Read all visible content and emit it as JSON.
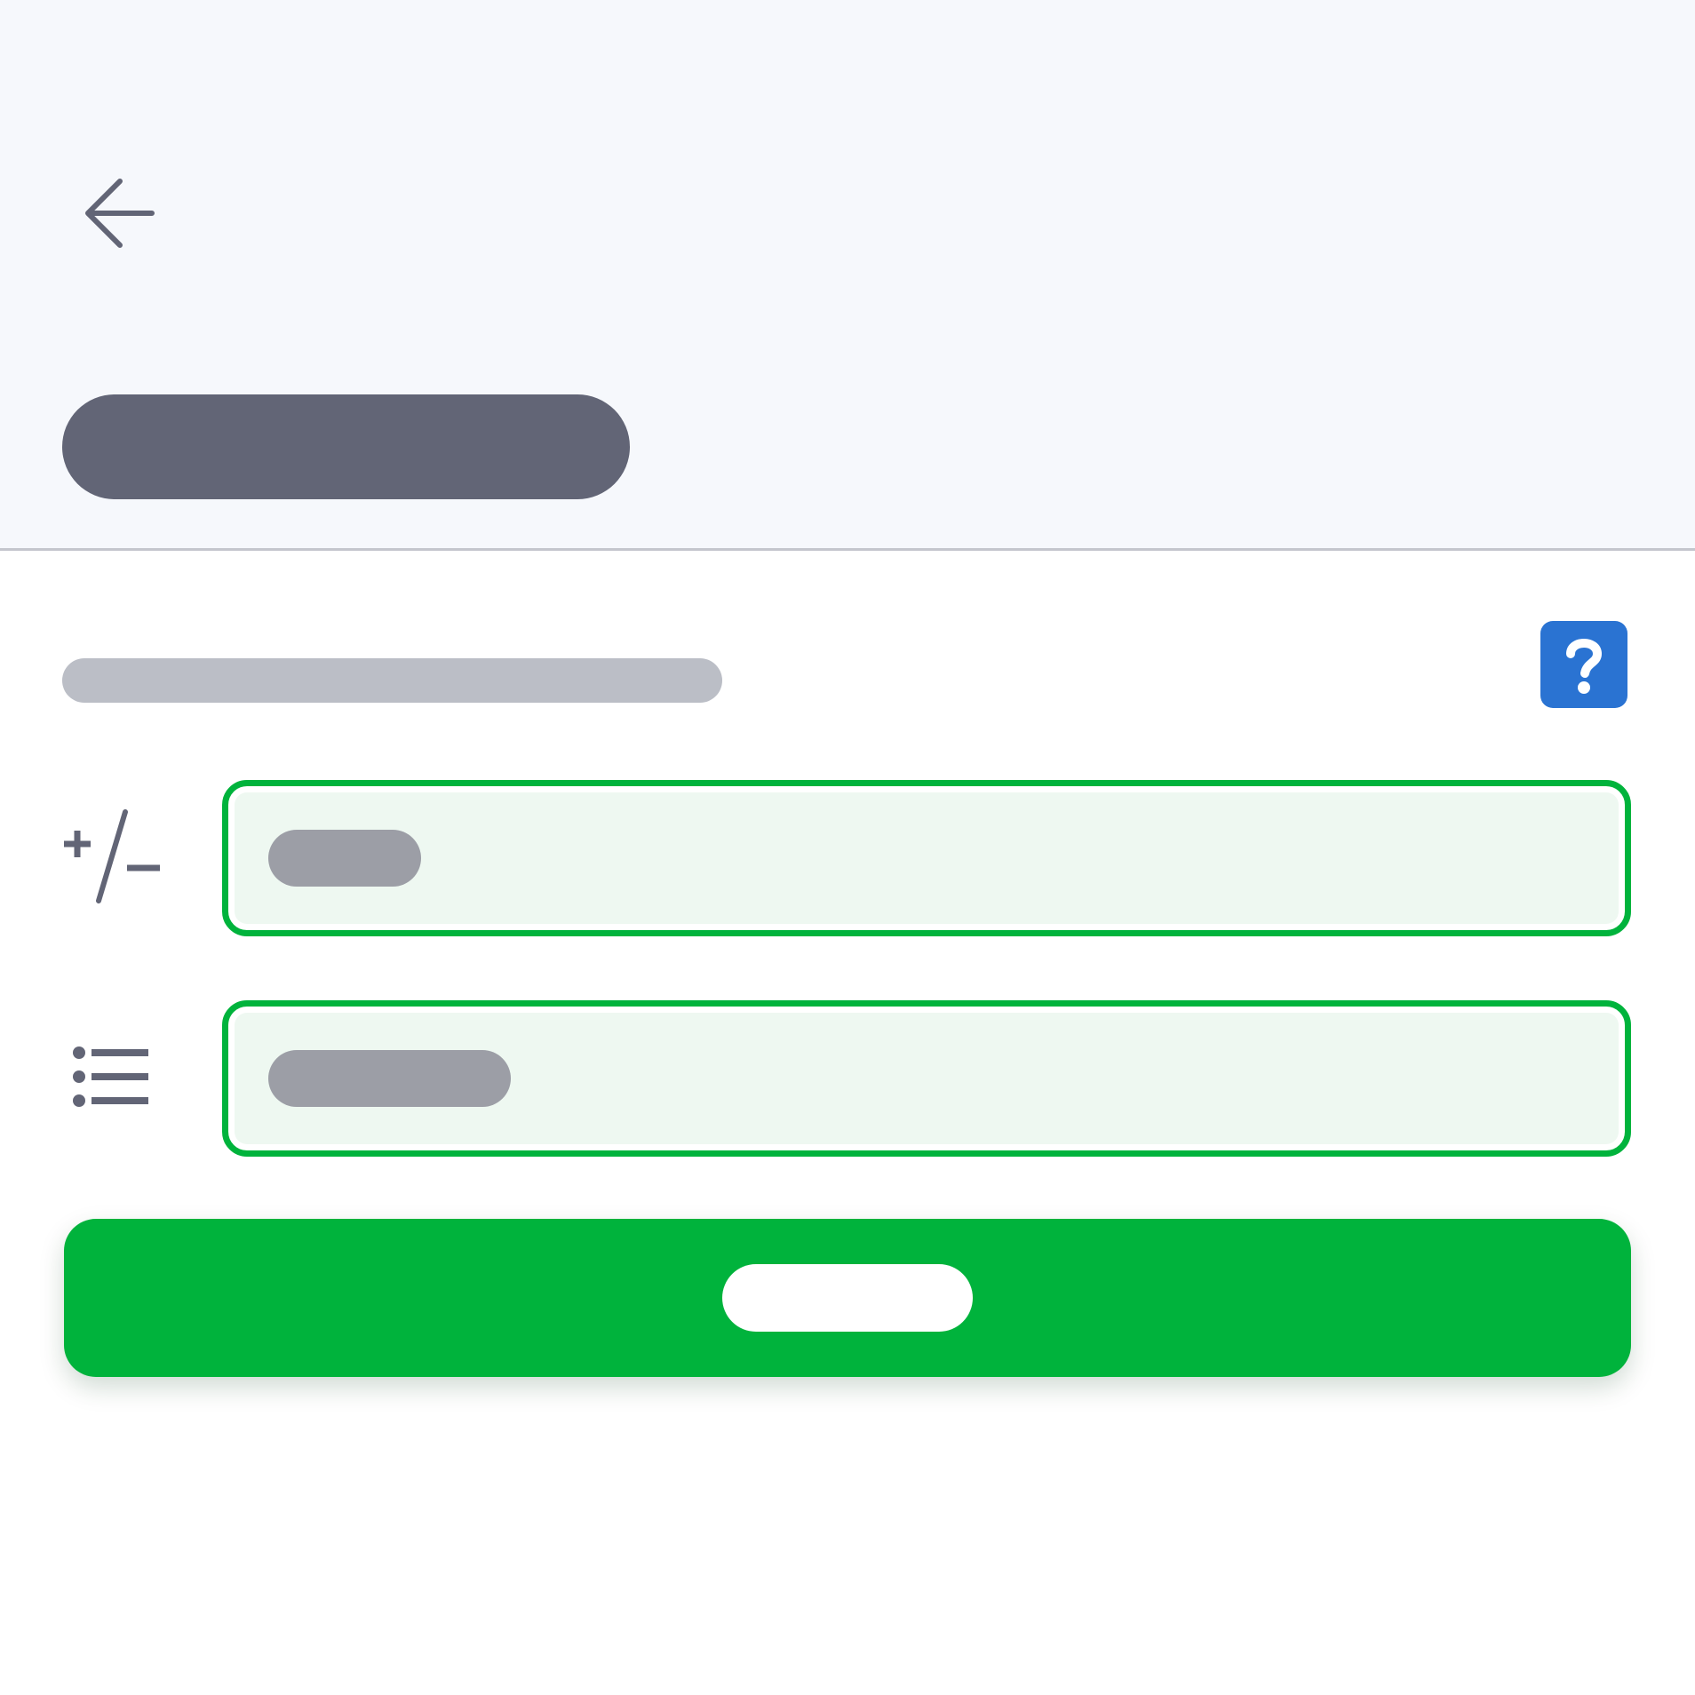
{
  "header": {
    "back_icon": "arrow-left-icon"
  },
  "content": {
    "help_icon": "question-mark-icon",
    "fields": [
      {
        "icon": "plus-minus-icon"
      },
      {
        "icon": "bulleted-list-icon"
      }
    ]
  },
  "colors": {
    "header_bg": "#f6f8fc",
    "accent_green": "#00b33c",
    "field_fill": "#eef8f1",
    "help_blue": "#2a73d2",
    "icon_gray": "#626576"
  }
}
